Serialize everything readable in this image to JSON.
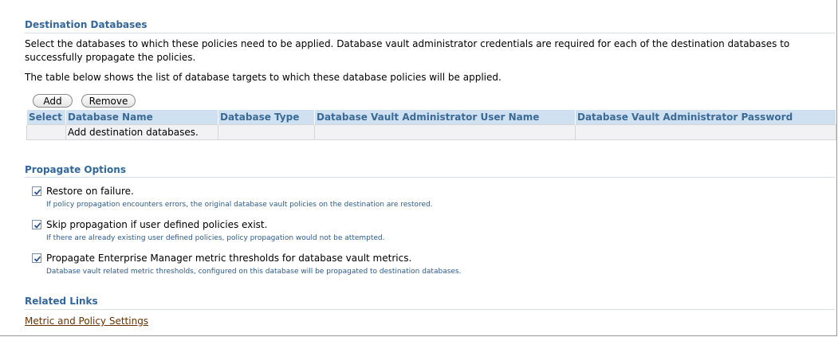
{
  "destination": {
    "title": "Destination Databases",
    "intro_line1": "Select the databases to which these policies need to be applied. Database vault administrator credentials are required for each of the destination databases to",
    "intro_line2": "successfully propagate the policies.",
    "table_note": "The table below shows the list of database targets to which these database policies will be applied.",
    "add_label": "Add",
    "remove_label": "Remove",
    "columns": [
      "Select",
      "Database Name",
      "Database Type",
      "Database Vault Administrator User Name",
      "Database Vault Administrator Password"
    ],
    "empty_row_text": "Add destination databases."
  },
  "propagate": {
    "title": "Propagate Options",
    "options": [
      {
        "label": "Restore on failure.",
        "description": "If policy propagation encounters errors, the original database vault policies on the destination are restored.",
        "checked": true
      },
      {
        "label": "Skip propagation if user defined policies exist.",
        "description": "If there are already existing user defined policies, policy propagation would not be attempted.",
        "checked": true
      },
      {
        "label": "Propagate Enterprise Manager metric thresholds for database vault metrics.",
        "description": "Database vault related metric thresholds, configured on this database will be propagated to destination databases.",
        "checked": true
      }
    ]
  },
  "related": {
    "title": "Related Links",
    "link_label": "Metric and Policy Settings"
  },
  "colors": {
    "section_title": "#336699",
    "header_bg": "#cfe0f1",
    "link": "#663300",
    "check": "#1c4a8c"
  },
  "icons": {
    "checkbox": "checkbox-checked-icon"
  }
}
